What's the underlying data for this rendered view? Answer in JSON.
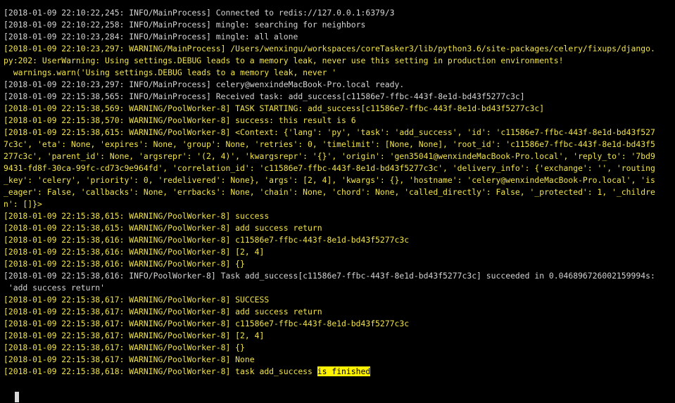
{
  "log": {
    "lines": [
      {
        "level": "info",
        "text": "[2018-01-09 22:10:22,245: INFO/MainProcess] Connected to redis://127.0.0.1:6379/3"
      },
      {
        "level": "info",
        "text": "[2018-01-09 22:10:22,258: INFO/MainProcess] mingle: searching for neighbors"
      },
      {
        "level": "info",
        "text": "[2018-01-09 22:10:23,284: INFO/MainProcess] mingle: all alone"
      },
      {
        "level": "warning",
        "text": "[2018-01-09 22:10:23,297: WARNING/MainProcess] /Users/wenxingu/workspaces/coreTasker3/lib/python3.6/site-packages/celery/fixups/django."
      },
      {
        "level": "warning",
        "text": "py:202: UserWarning: Using settings.DEBUG leads to a memory leak, never use this setting in production environments!"
      },
      {
        "level": "warning",
        "text": "  warnings.warn('Using settings.DEBUG leads to a memory leak, never '"
      },
      {
        "level": "info",
        "text": "[2018-01-09 22:10:23,297: INFO/MainProcess] celery@wenxindeMacBook-Pro.local ready."
      },
      {
        "level": "info",
        "text": "[2018-01-09 22:15:38,565: INFO/MainProcess] Received task: add_success[c11586e7-ffbc-443f-8e1d-bd43f5277c3c]"
      },
      {
        "level": "warning",
        "text": "[2018-01-09 22:15:38,569: WARNING/PoolWorker-8] TASK STARTING: add_success[c11586e7-ffbc-443f-8e1d-bd43f5277c3c]"
      },
      {
        "level": "warning",
        "text": "[2018-01-09 22:15:38,570: WARNING/PoolWorker-8] success: this result is 6"
      },
      {
        "level": "warning",
        "text": "[2018-01-09 22:15:38,615: WARNING/PoolWorker-8] <Context: {'lang': 'py', 'task': 'add_success', 'id': 'c11586e7-ffbc-443f-8e1d-bd43f527"
      },
      {
        "level": "warning",
        "text": "7c3c', 'eta': None, 'expires': None, 'group': None, 'retries': 0, 'timelimit': [None, None], 'root_id': 'c11586e7-ffbc-443f-8e1d-bd43f5"
      },
      {
        "level": "warning",
        "text": "277c3c', 'parent_id': None, 'argsrepr': '(2, 4)', 'kwargsrepr': '{}', 'origin': 'gen35041@wenxindeMacBook-Pro.local', 'reply_to': '7bd9"
      },
      {
        "level": "warning",
        "text": "9431-fd8f-30ca-99fc-cd73c9e964fd', 'correlation_id': 'c11586e7-ffbc-443f-8e1d-bd43f5277c3c', 'delivery_info': {'exchange': '', 'routing"
      },
      {
        "level": "warning",
        "text": "_key': 'celery', 'priority': 0, 'redelivered': None}, 'args': [2, 4], 'kwargs': {}, 'hostname': 'celery@wenxindeMacBook-Pro.local', 'is"
      },
      {
        "level": "warning",
        "text": "_eager': False, 'callbacks': None, 'errbacks': None, 'chain': None, 'chord': None, 'called_directly': False, '_protected': 1, '_childre"
      },
      {
        "level": "warning",
        "text": "n': []}>"
      },
      {
        "level": "warning",
        "text": "[2018-01-09 22:15:38,615: WARNING/PoolWorker-8] success"
      },
      {
        "level": "warning",
        "text": "[2018-01-09 22:15:38,615: WARNING/PoolWorker-8] add success return"
      },
      {
        "level": "warning",
        "text": "[2018-01-09 22:15:38,616: WARNING/PoolWorker-8] c11586e7-ffbc-443f-8e1d-bd43f5277c3c"
      },
      {
        "level": "warning",
        "text": "[2018-01-09 22:15:38,616: WARNING/PoolWorker-8] [2, 4]"
      },
      {
        "level": "warning",
        "text": "[2018-01-09 22:15:38,616: WARNING/PoolWorker-8] {}"
      },
      {
        "level": "info",
        "text": "[2018-01-09 22:15:38,616: INFO/PoolWorker-8] Task add_success[c11586e7-ffbc-443f-8e1d-bd43f5277c3c] succeeded in 0.046896726002159994s:"
      },
      {
        "level": "info",
        "text": " 'add success return'"
      },
      {
        "level": "warning",
        "text": "[2018-01-09 22:15:38,617: WARNING/PoolWorker-8] SUCCESS"
      },
      {
        "level": "warning",
        "text": "[2018-01-09 22:15:38,617: WARNING/PoolWorker-8] add success return"
      },
      {
        "level": "warning",
        "text": "[2018-01-09 22:15:38,617: WARNING/PoolWorker-8] c11586e7-ffbc-443f-8e1d-bd43f5277c3c"
      },
      {
        "level": "warning",
        "text": "[2018-01-09 22:15:38,617: WARNING/PoolWorker-8] [2, 4]"
      },
      {
        "level": "warning",
        "text": "[2018-01-09 22:15:38,617: WARNING/PoolWorker-8] {}"
      },
      {
        "level": "warning",
        "text": "[2018-01-09 22:15:38,617: WARNING/PoolWorker-8] None"
      },
      {
        "level": "warning",
        "text": "[2018-01-09 22:15:38,618: WARNING/PoolWorker-8] task add_success ",
        "highlight": "is finished"
      }
    ]
  },
  "colors": {
    "background": "#000000",
    "info_text": "#d4d4d4",
    "warning_text": "#f2e44a",
    "highlight_bg": "#fff200",
    "cursor": "#d8d8d8"
  },
  "cursor": {
    "icon": "block-cursor-icon"
  }
}
